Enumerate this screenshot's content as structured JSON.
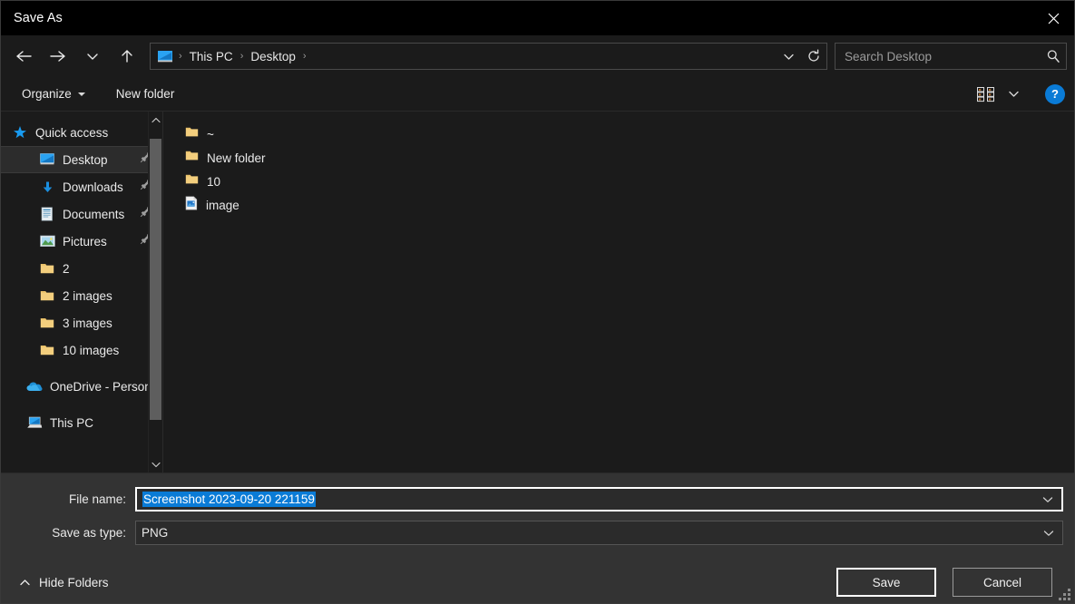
{
  "window": {
    "title": "Save As",
    "close_icon": "close-icon"
  },
  "nav": {
    "back_icon": "arrow-left-icon",
    "forward_icon": "arrow-right-icon",
    "recent_icon": "chevron-down-icon",
    "up_icon": "arrow-up-icon",
    "breadcrumb": {
      "root_icon": "monitor-icon",
      "items": [
        {
          "label": "This PC"
        },
        {
          "label": "Desktop"
        }
      ],
      "separator": "›"
    },
    "dropdown_icon": "chevron-down-icon",
    "refresh_icon": "refresh-icon"
  },
  "search": {
    "placeholder": "Search Desktop",
    "value": "",
    "icon": "search-icon"
  },
  "toolbar": {
    "organize_label": "Organize",
    "new_folder_label": "New folder",
    "view_icon": "view-tiles-icon",
    "view_caret_icon": "chevron-down-icon",
    "help_label": "?",
    "help_icon": "help-icon"
  },
  "sidebar": {
    "scroll_up_icon": "chevron-up-icon",
    "scroll_down_icon": "chevron-down-icon",
    "items": [
      {
        "label": "Quick access",
        "icon": "star-icon",
        "level": "root",
        "pinned": false,
        "selected": false
      },
      {
        "label": "Desktop",
        "icon": "monitor-icon",
        "level": "child",
        "pinned": true,
        "selected": true
      },
      {
        "label": "Downloads",
        "icon": "download-icon",
        "level": "child",
        "pinned": true,
        "selected": false
      },
      {
        "label": "Documents",
        "icon": "document-icon",
        "level": "child",
        "pinned": true,
        "selected": false
      },
      {
        "label": "Pictures",
        "icon": "pictures-icon",
        "level": "child",
        "pinned": true,
        "selected": false
      },
      {
        "label": "2",
        "icon": "folder-icon",
        "level": "child",
        "pinned": false,
        "selected": false
      },
      {
        "label": "2 images",
        "icon": "folder-icon",
        "level": "child",
        "pinned": false,
        "selected": false
      },
      {
        "label": "3 images",
        "icon": "folder-icon",
        "level": "child",
        "pinned": false,
        "selected": false
      },
      {
        "label": "10 images",
        "icon": "folder-icon",
        "level": "child",
        "pinned": false,
        "selected": false
      },
      {
        "label": "OneDrive - Person",
        "icon": "onedrive-icon",
        "level": "root2",
        "pinned": false,
        "selected": false
      },
      {
        "label": "This PC",
        "icon": "pc-icon",
        "level": "root2",
        "pinned": false,
        "selected": false
      }
    ]
  },
  "files": [
    {
      "name": "~",
      "icon": "folder-icon",
      "type": "folder"
    },
    {
      "name": "New folder",
      "icon": "folder-icon",
      "type": "folder"
    },
    {
      "name": "10",
      "icon": "folder-icon",
      "type": "folder"
    },
    {
      "name": "image",
      "icon": "image-file-icon",
      "type": "file"
    }
  ],
  "form": {
    "filename_label": "File name:",
    "filename_value": "Screenshot 2023-09-20 221159",
    "filetype_label": "Save as type:",
    "filetype_value": "PNG",
    "dropdown_icon": "chevron-down-icon"
  },
  "footer": {
    "hide_folders_label": "Hide Folders",
    "hide_folders_icon": "chevron-up-icon",
    "save_label": "Save",
    "cancel_label": "Cancel",
    "resize_grip_icon": "resize-grip-icon"
  },
  "colors": {
    "accent": "#0a7bd6",
    "window_bg": "#1b1b1b",
    "panel_bg": "#333333",
    "titlebar_bg": "#000000",
    "folder_yellow": "#f5cd7b"
  }
}
